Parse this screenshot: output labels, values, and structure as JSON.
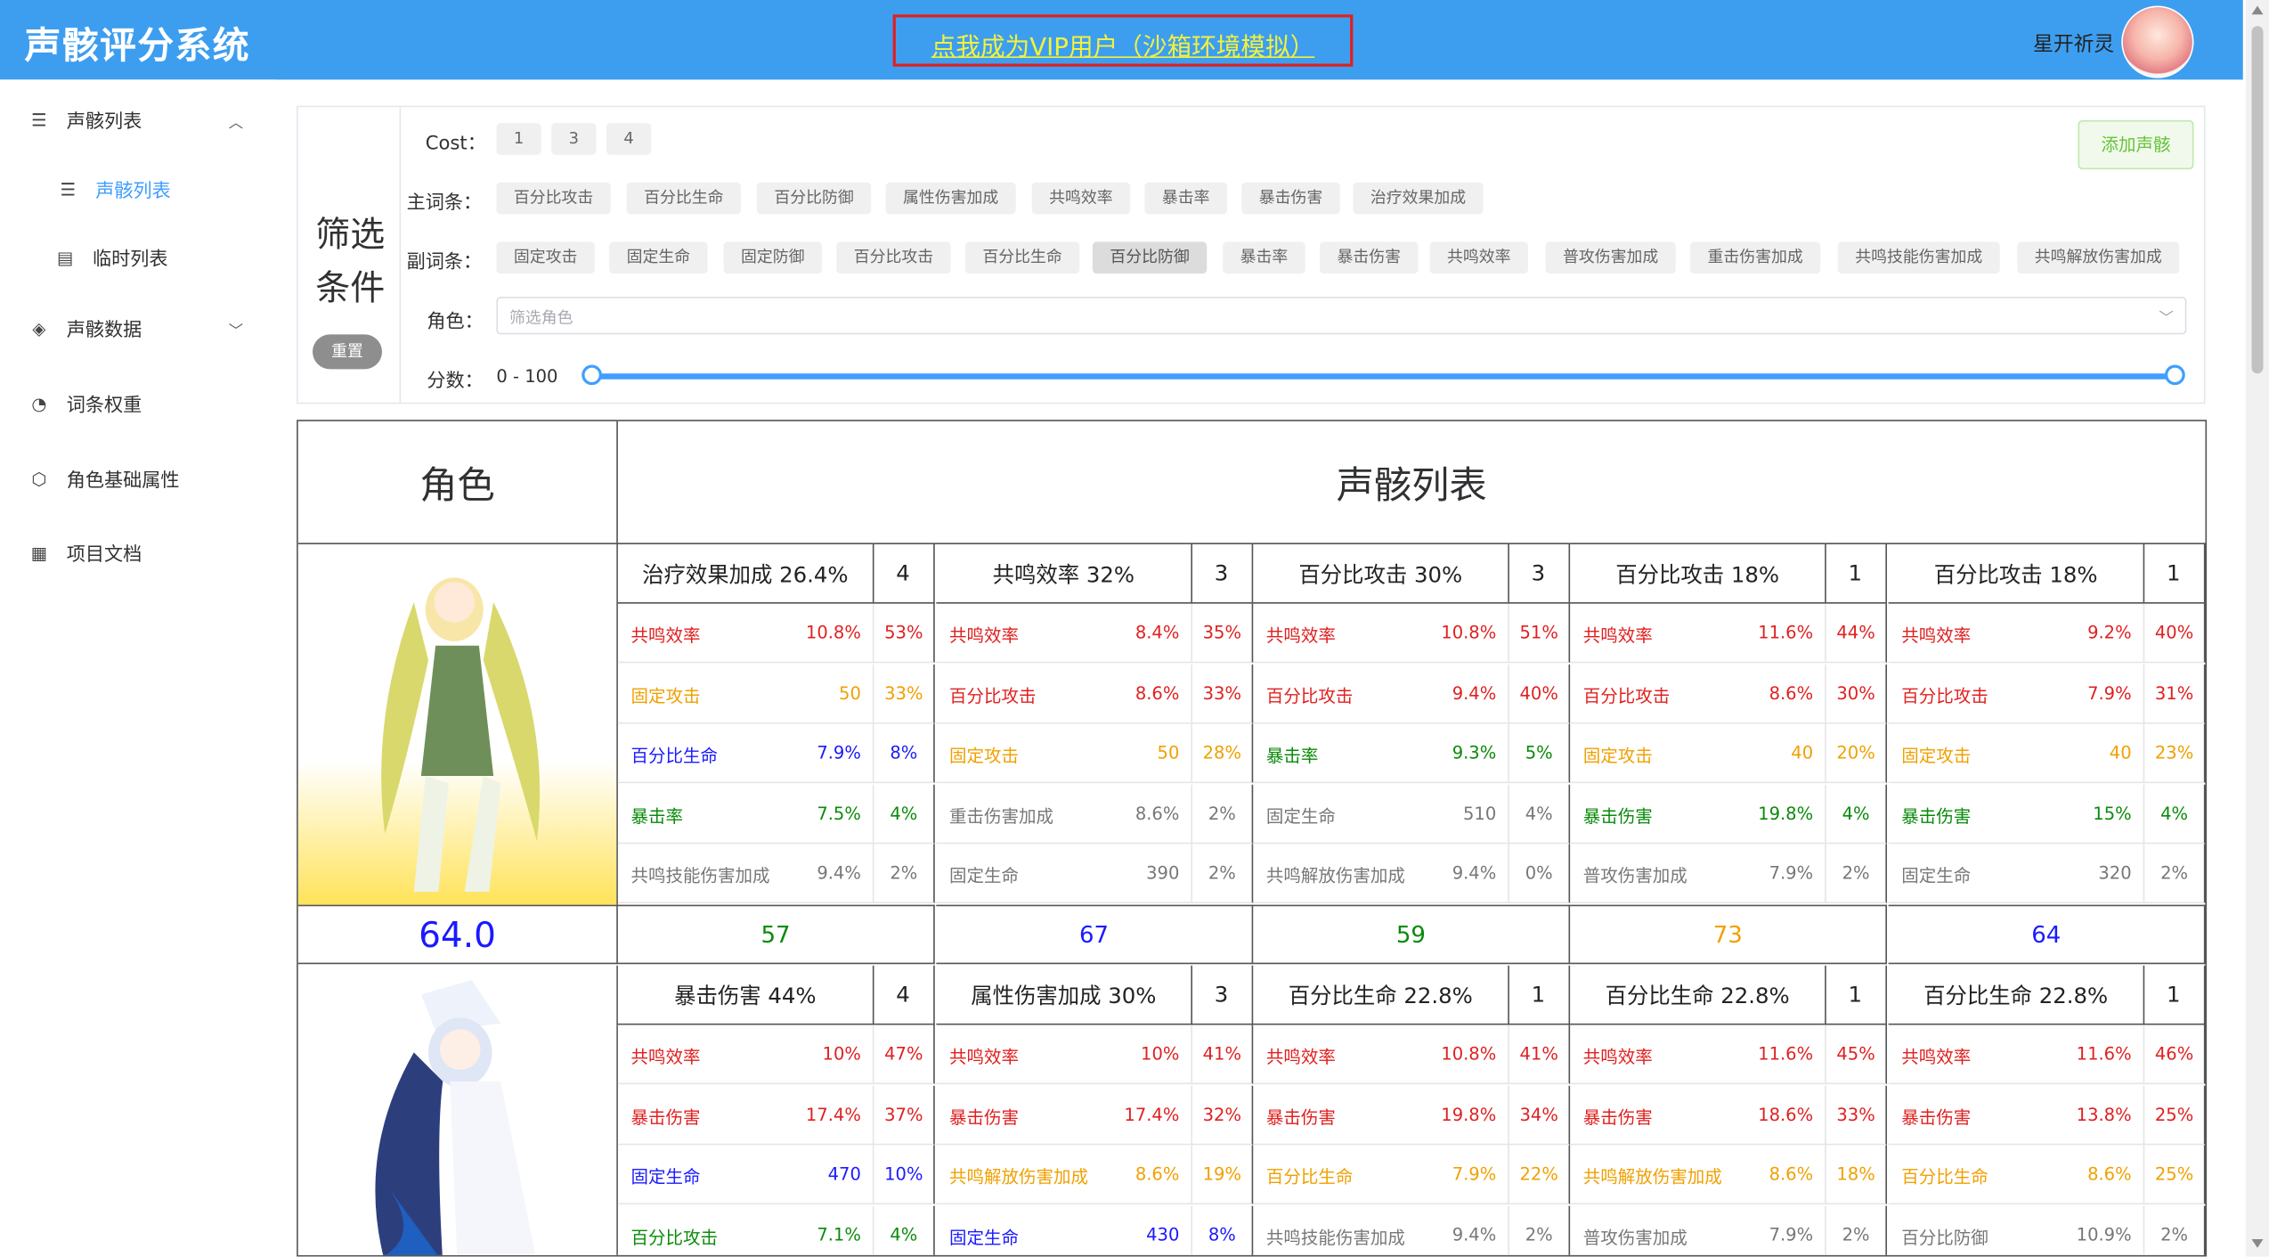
{
  "header": {
    "app_title": "声骸评分系统",
    "vip_link": "点我成为VIP用户（沙箱环境模拟）",
    "username": "星开祈灵"
  },
  "sidebar": {
    "items": [
      {
        "label": "声骸列表",
        "icon": "list-icon",
        "expanded": true
      },
      {
        "label": "声骸列表",
        "icon": "list-icon",
        "active": true
      },
      {
        "label": "临时列表",
        "icon": "document-icon"
      },
      {
        "label": "声骸数据",
        "icon": "layers-icon",
        "expanded": false
      },
      {
        "label": "词条权重",
        "icon": "pie-icon"
      },
      {
        "label": "角色基础属性",
        "icon": "cube-icon"
      },
      {
        "label": "项目文档",
        "icon": "doc-icon"
      }
    ]
  },
  "filter": {
    "title": "筛选条件",
    "reset": "重置",
    "add_button": "添加声骸",
    "cost_label": "Cost：",
    "cost_options": [
      "1",
      "3",
      "4"
    ],
    "main_label": "主词条：",
    "main_options": [
      "百分比攻击",
      "百分比生命",
      "百分比防御",
      "属性伤害加成",
      "共鸣效率",
      "暴击率",
      "暴击伤害",
      "治疗效果加成"
    ],
    "sub_label": "副词条：",
    "sub_options": [
      "固定攻击",
      "固定生命",
      "固定防御",
      "百分比攻击",
      "百分比生命",
      "百分比防御",
      "暴击率",
      "暴击伤害",
      "共鸣效率",
      "普攻伤害加成",
      "重击伤害加成",
      "共鸣技能伤害加成",
      "共鸣解放伤害加成"
    ],
    "sub_selected": "百分比防御",
    "role_label": "角色：",
    "role_placeholder": "筛选角色",
    "score_label": "分数：",
    "score_range": "0 - 100",
    "score_min": 0,
    "score_max": 100
  },
  "table": {
    "col_role": "角色",
    "col_list": "声骸列表",
    "rows": [
      {
        "score": "64.0",
        "echoes": [
          {
            "main": "治疗效果加成 26.4%",
            "cost": "4",
            "score": "57",
            "score_color": "green",
            "subs": [
              [
                "共鸣效率",
                "10.8%",
                "53%",
                "red"
              ],
              [
                "固定攻击",
                "50",
                "33%",
                "orange"
              ],
              [
                "百分比生命",
                "7.9%",
                "8%",
                "blue"
              ],
              [
                "暴击率",
                "7.5%",
                "4%",
                "green"
              ],
              [
                "共鸣技能伤害加成",
                "9.4%",
                "2%",
                "gray"
              ]
            ]
          },
          {
            "main": "共鸣效率 32%",
            "cost": "3",
            "score": "67",
            "score_color": "blue",
            "subs": [
              [
                "共鸣效率",
                "8.4%",
                "35%",
                "red"
              ],
              [
                "百分比攻击",
                "8.6%",
                "33%",
                "red"
              ],
              [
                "固定攻击",
                "50",
                "28%",
                "orange"
              ],
              [
                "重击伤害加成",
                "8.6%",
                "2%",
                "gray"
              ],
              [
                "固定生命",
                "390",
                "2%",
                "gray"
              ]
            ]
          },
          {
            "main": "百分比攻击 30%",
            "cost": "3",
            "score": "59",
            "score_color": "green",
            "subs": [
              [
                "共鸣效率",
                "10.8%",
                "51%",
                "red"
              ],
              [
                "百分比攻击",
                "9.4%",
                "40%",
                "red"
              ],
              [
                "暴击率",
                "9.3%",
                "5%",
                "green"
              ],
              [
                "固定生命",
                "510",
                "4%",
                "gray"
              ],
              [
                "共鸣解放伤害加成",
                "9.4%",
                "0%",
                "gray"
              ]
            ]
          },
          {
            "main": "百分比攻击 18%",
            "cost": "1",
            "score": "73",
            "score_color": "orange",
            "subs": [
              [
                "共鸣效率",
                "11.6%",
                "44%",
                "red"
              ],
              [
                "百分比攻击",
                "8.6%",
                "30%",
                "red"
              ],
              [
                "固定攻击",
                "40",
                "20%",
                "orange"
              ],
              [
                "暴击伤害",
                "19.8%",
                "4%",
                "green"
              ],
              [
                "普攻伤害加成",
                "7.9%",
                "2%",
                "gray"
              ]
            ]
          },
          {
            "main": "百分比攻击 18%",
            "cost": "1",
            "score": "64",
            "score_color": "blue",
            "subs": [
              [
                "共鸣效率",
                "9.2%",
                "40%",
                "red"
              ],
              [
                "百分比攻击",
                "7.9%",
                "31%",
                "red"
              ],
              [
                "固定攻击",
                "40",
                "23%",
                "orange"
              ],
              [
                "暴击伤害",
                "15%",
                "4%",
                "green"
              ],
              [
                "固定生命",
                "320",
                "2%",
                "gray"
              ]
            ]
          }
        ]
      },
      {
        "score": "",
        "echoes": [
          {
            "main": "暴击伤害 44%",
            "cost": "4",
            "subs": [
              [
                "共鸣效率",
                "10%",
                "47%",
                "red"
              ],
              [
                "暴击伤害",
                "17.4%",
                "37%",
                "red"
              ],
              [
                "固定生命",
                "470",
                "10%",
                "blue"
              ],
              [
                "百分比攻击",
                "7.1%",
                "4%",
                "green"
              ]
            ]
          },
          {
            "main": "属性伤害加成 30%",
            "cost": "3",
            "subs": [
              [
                "共鸣效率",
                "10%",
                "41%",
                "red"
              ],
              [
                "暴击伤害",
                "17.4%",
                "32%",
                "red"
              ],
              [
                "共鸣解放伤害加成",
                "8.6%",
                "19%",
                "orange"
              ],
              [
                "固定生命",
                "430",
                "8%",
                "blue"
              ]
            ]
          },
          {
            "main": "百分比生命 22.8%",
            "cost": "1",
            "subs": [
              [
                "共鸣效率",
                "10.8%",
                "41%",
                "red"
              ],
              [
                "暴击伤害",
                "19.8%",
                "34%",
                "red"
              ],
              [
                "百分比生命",
                "7.9%",
                "22%",
                "orange"
              ],
              [
                "共鸣技能伤害加成",
                "9.4%",
                "2%",
                "gray"
              ]
            ]
          },
          {
            "main": "百分比生命 22.8%",
            "cost": "1",
            "subs": [
              [
                "共鸣效率",
                "11.6%",
                "45%",
                "red"
              ],
              [
                "暴击伤害",
                "18.6%",
                "33%",
                "red"
              ],
              [
                "共鸣解放伤害加成",
                "8.6%",
                "18%",
                "orange"
              ],
              [
                "普攻伤害加成",
                "7.9%",
                "2%",
                "gray"
              ]
            ]
          },
          {
            "main": "百分比生命 22.8%",
            "cost": "1",
            "subs": [
              [
                "共鸣效率",
                "11.6%",
                "46%",
                "red"
              ],
              [
                "暴击伤害",
                "13.8%",
                "25%",
                "red"
              ],
              [
                "百分比生命",
                "8.6%",
                "25%",
                "orange"
              ],
              [
                "百分比防御",
                "10.9%",
                "2%",
                "gray"
              ]
            ]
          }
        ]
      }
    ]
  },
  "colors": {
    "header": "#3d9ef0",
    "accent": "#409eff",
    "vip": "#f2f23c",
    "vip_border": "#e02020"
  }
}
